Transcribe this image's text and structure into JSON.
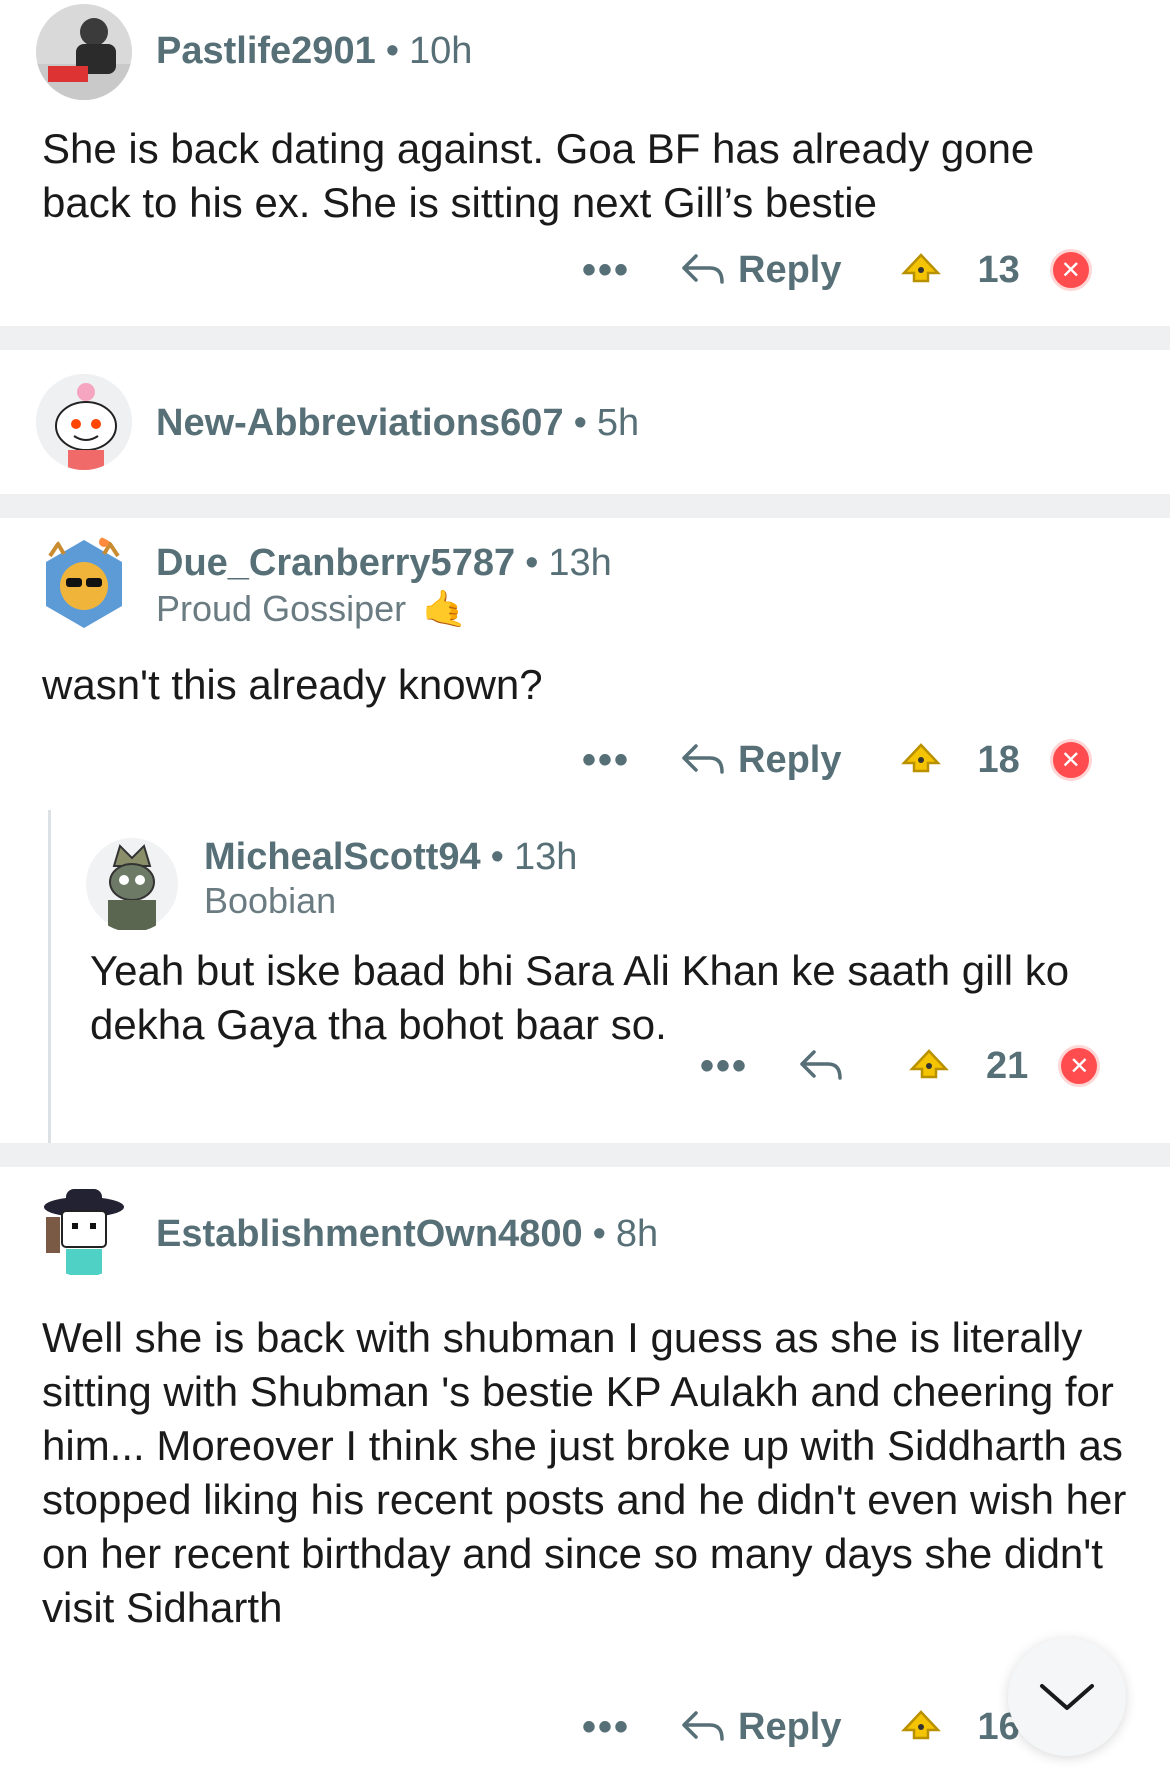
{
  "comments": [
    {
      "username": "Pastlife2901",
      "age": "10h",
      "body": "She is back dating against. Goa BF has already gone back to his ex. She is sitting next Gill’s bestie",
      "reply_label": "Reply",
      "score": "13"
    },
    {
      "username": "New-Abbreviations607",
      "age": "5h"
    },
    {
      "username": "Due_Cranberry5787",
      "age": "13h",
      "flair": "Proud Gossiper",
      "flair_emoji": "🤙",
      "body": "wasn't this already known?",
      "reply_label": "Reply",
      "score": "18"
    },
    {
      "username": "MichealScott94",
      "age": "13h",
      "flair": "Boobian",
      "body": "Yeah but iske baad bhi Sara Ali Khan ke saath gill ko dekha Gaya tha bohot baar so.",
      "score": "21"
    },
    {
      "username": "EstablishmentOwn4800",
      "age": "8h",
      "body": "Well she is back with shubman I guess as she is literally sitting with Shubman 's bestie KP Aulakh and cheering for him... Moreover I think she just broke up with Siddharth as stopped liking his recent posts and he didn't even wish her on her recent birthday and since so many days she didn't visit Sidharth",
      "reply_label": "Reply",
      "score": "16"
    }
  ],
  "more_label": "•••",
  "dot": "•",
  "down_label": "✕",
  "colors": {
    "meta": "#576f76",
    "text": "#1a1a1b",
    "separator": "#eef0f1",
    "downvote": "#ff4d4f"
  }
}
